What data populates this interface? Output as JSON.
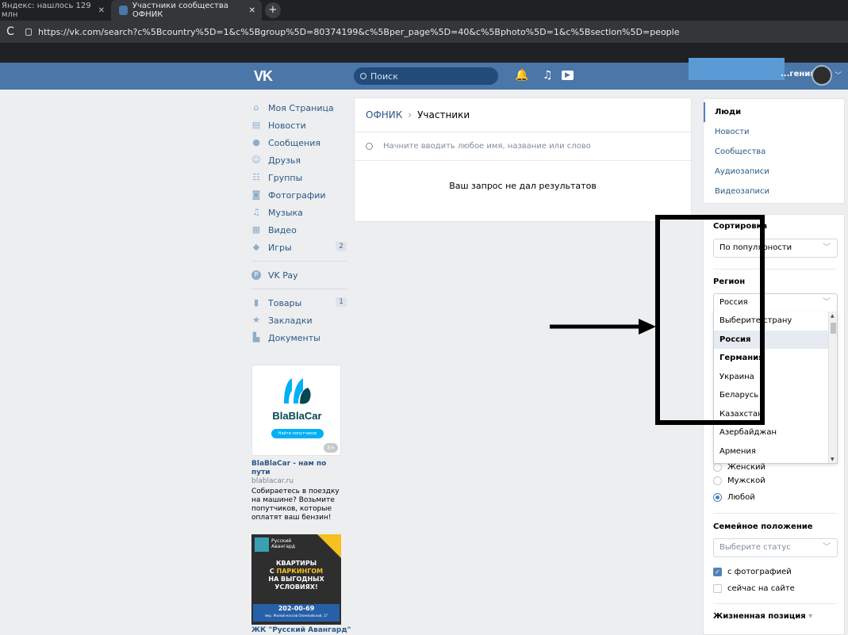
{
  "browser": {
    "tab1_title": "Яндекс: нашлось 129 млн",
    "tab1_close": "✕",
    "tab2_title": "Участники сообщества ОФНИК",
    "tab2_close": "✕",
    "new_tab": "+",
    "reload": "C",
    "url": "https://vk.com/search?c%5Bcountry%5D=1&c%5Bgroup%5D=80374199&c%5Bper_page%5D=40&c%5Bphoto%5D=1&c%5Bsection%5D=people"
  },
  "header": {
    "logo": "VK",
    "search_placeholder": "Поиск",
    "username": "...гений",
    "bell_icon": "🔔",
    "music_icon": "♫",
    "play_icon": "▶"
  },
  "left_nav": {
    "items": [
      {
        "label": "Моя Страница",
        "icon": "⌂",
        "name": "home-icon"
      },
      {
        "label": "Новости",
        "icon": "▤",
        "name": "news-icon"
      },
      {
        "label": "Сообщения",
        "icon": "●",
        "name": "messages-icon"
      },
      {
        "label": "Друзья",
        "icon": "☺",
        "name": "friends-icon"
      },
      {
        "label": "Группы",
        "icon": "☷",
        "name": "groups-icon"
      },
      {
        "label": "Фотографии",
        "icon": "◙",
        "name": "photo-icon"
      },
      {
        "label": "Музыка",
        "icon": "♫",
        "name": "music-icon"
      },
      {
        "label": "Видео",
        "icon": "▦",
        "name": "video-icon"
      },
      {
        "label": "Игры",
        "icon": "◆",
        "name": "games-icon",
        "count": "2"
      }
    ],
    "vkpay": {
      "label": "VK Pay",
      "icon": "Ⓟ"
    },
    "items2": [
      {
        "label": "Товары",
        "icon": "▮",
        "name": "goods-icon",
        "count": "1"
      },
      {
        "label": "Закладки",
        "icon": "★",
        "name": "bookmarks-icon"
      },
      {
        "label": "Документы",
        "icon": "▙",
        "name": "documents-icon"
      }
    ]
  },
  "ads": {
    "ad1": {
      "brand": "BlaBlaCar",
      "button": "Найти попутчиков",
      "age": "3+",
      "title": "BlaBlaCar - нам по пути",
      "site": "blablacar.ru",
      "desc": "Собираетесь в поездку на машине? Возьмите попутчиков, которые оплатят ваш бензин!"
    },
    "ad2": {
      "brand_line1": "Русский",
      "brand_line2": "Авангард",
      "hl1": "КВАРТИРЫ",
      "hl2a": "С ",
      "hl2b": "ПАРКИНГОМ",
      "hl3": "НА ВЫГОДНЫХ",
      "hl4": "УСЛОВИЯХ!",
      "phone": "202-00-69",
      "address": "мкр. Жилой массив Олимпийский, 17",
      "title": "ЖК \"Русский Авангард\""
    }
  },
  "main": {
    "breadcrumb_group": "ОФНИК",
    "breadcrumb_sep": "›",
    "breadcrumb_current": "Участники",
    "search_placeholder": "Начните вводить любое имя, название или слово",
    "no_results": "Ваш запрос не дал результатов"
  },
  "right_menu": {
    "items": [
      "Люди",
      "Новости",
      "Сообщества",
      "Аудиозаписи",
      "Видеозаписи"
    ]
  },
  "filters": {
    "sort_label": "Сортировка",
    "sort_value": "По популярности",
    "region_label": "Регион",
    "region_value": "Россия",
    "dropdown_options": [
      "Выберите страну",
      "Россия",
      "Германия",
      "Украина",
      "Беларусь",
      "Казахстан",
      "Азербайджан",
      "Армения"
    ],
    "gender_partial": "Женский",
    "gender_male": "Мужской",
    "gender_any": "Любой",
    "family_label": "Семейное положение",
    "family_placeholder": "Выберите статус",
    "with_photo": "с фотографией",
    "online_now": "сейчас на сайте",
    "life_position": "Жизненная позиция",
    "chevron": "﹀"
  },
  "colors": {
    "vk_blue": "#4a76a8",
    "link": "#2a5885",
    "page_bg": "#edeef0"
  }
}
